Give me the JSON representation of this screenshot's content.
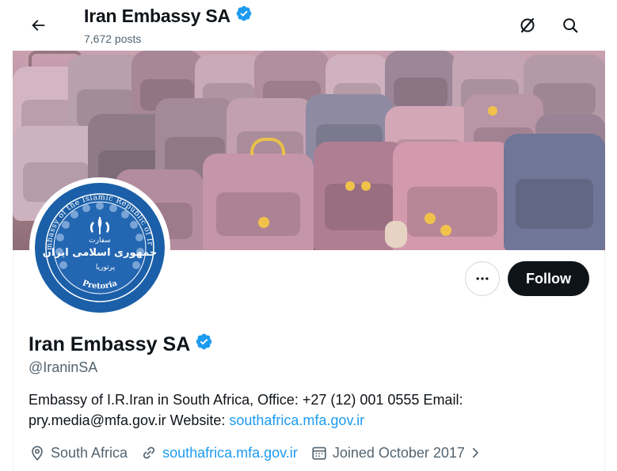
{
  "header": {
    "title": "Iran Embassy SA",
    "posts_count": "7,672 posts"
  },
  "icons": {
    "back": "arrow-left-icon",
    "hide": "hide-circle-icon",
    "search": "search-icon",
    "verified": "verified-badge-icon",
    "more": "more-dots-icon",
    "location": "location-pin-icon",
    "link": "link-icon",
    "calendar": "calendar-icon",
    "chevron": "chevron-right-icon"
  },
  "colors": {
    "accent": "#1d9bf0",
    "text": "#0f1419",
    "muted": "#536471",
    "follow_bg": "#0f1419",
    "seal_blue": "#1b5fa8"
  },
  "avatar": {
    "seal_text_top": "Embassy of the Islamic Republic of Iran",
    "seal_text_bottom": "Pretoria",
    "seal_farsi_1": "سفارت",
    "seal_farsi_2": "جمهوری اسلامی ایران",
    "seal_farsi_3": "پرتوریا"
  },
  "actions": {
    "follow_label": "Follow"
  },
  "profile": {
    "name": "Iran Embassy SA",
    "handle": "@IraninSA",
    "bio_text": "Embassy of I.R.Iran in South Africa, Office: +27 (12) 001 0555  Email: pry.media@mfa.gov.ir  Website: ",
    "bio_link": "southafrica.mfa.gov.ir",
    "location": "South Africa",
    "website": "southafrica.mfa.gov.ir",
    "joined": "Joined October 2017"
  }
}
